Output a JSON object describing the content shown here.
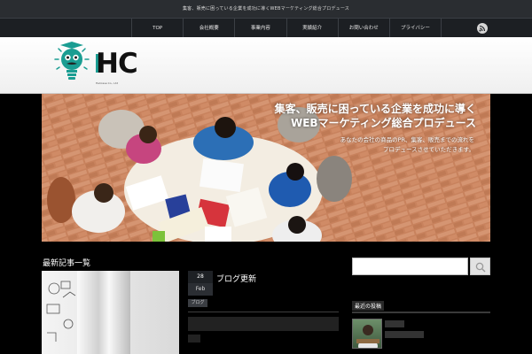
{
  "topbar": {
    "text": "集客、販売に困っている企業を成功に導くWEBマーケティング総合プロデュース"
  },
  "nav": {
    "items": [
      "TOP",
      "会社概要",
      "事業内容",
      "実績紹介",
      "お問い合わせ",
      "プライバシー"
    ],
    "rss_icon": "rss-icon"
  },
  "logo": {
    "text": "HC",
    "sub": "Helicase Co., Ltd"
  },
  "hero": {
    "headline1": "集客、販売に困っている企業を成功に導く",
    "headline2": "WEBマーケティング総合プロデュース",
    "sub1": "あなたの会社の商品のPR、集客、販売までの流れを",
    "sub2": "プロデュースさせていただきます。"
  },
  "main": {
    "section_title": "最新記事一覧",
    "post": {
      "day": "28",
      "month": "Feb",
      "title": "ブログ更新",
      "category": "ブログ"
    }
  },
  "sidebar": {
    "search_placeholder": "",
    "search_icon": "search-icon",
    "heading": "最近の投稿"
  },
  "colors": {
    "accent": "#1a9d92",
    "nav_bg": "#1c1f23",
    "topbar_bg": "#2a2d31"
  }
}
